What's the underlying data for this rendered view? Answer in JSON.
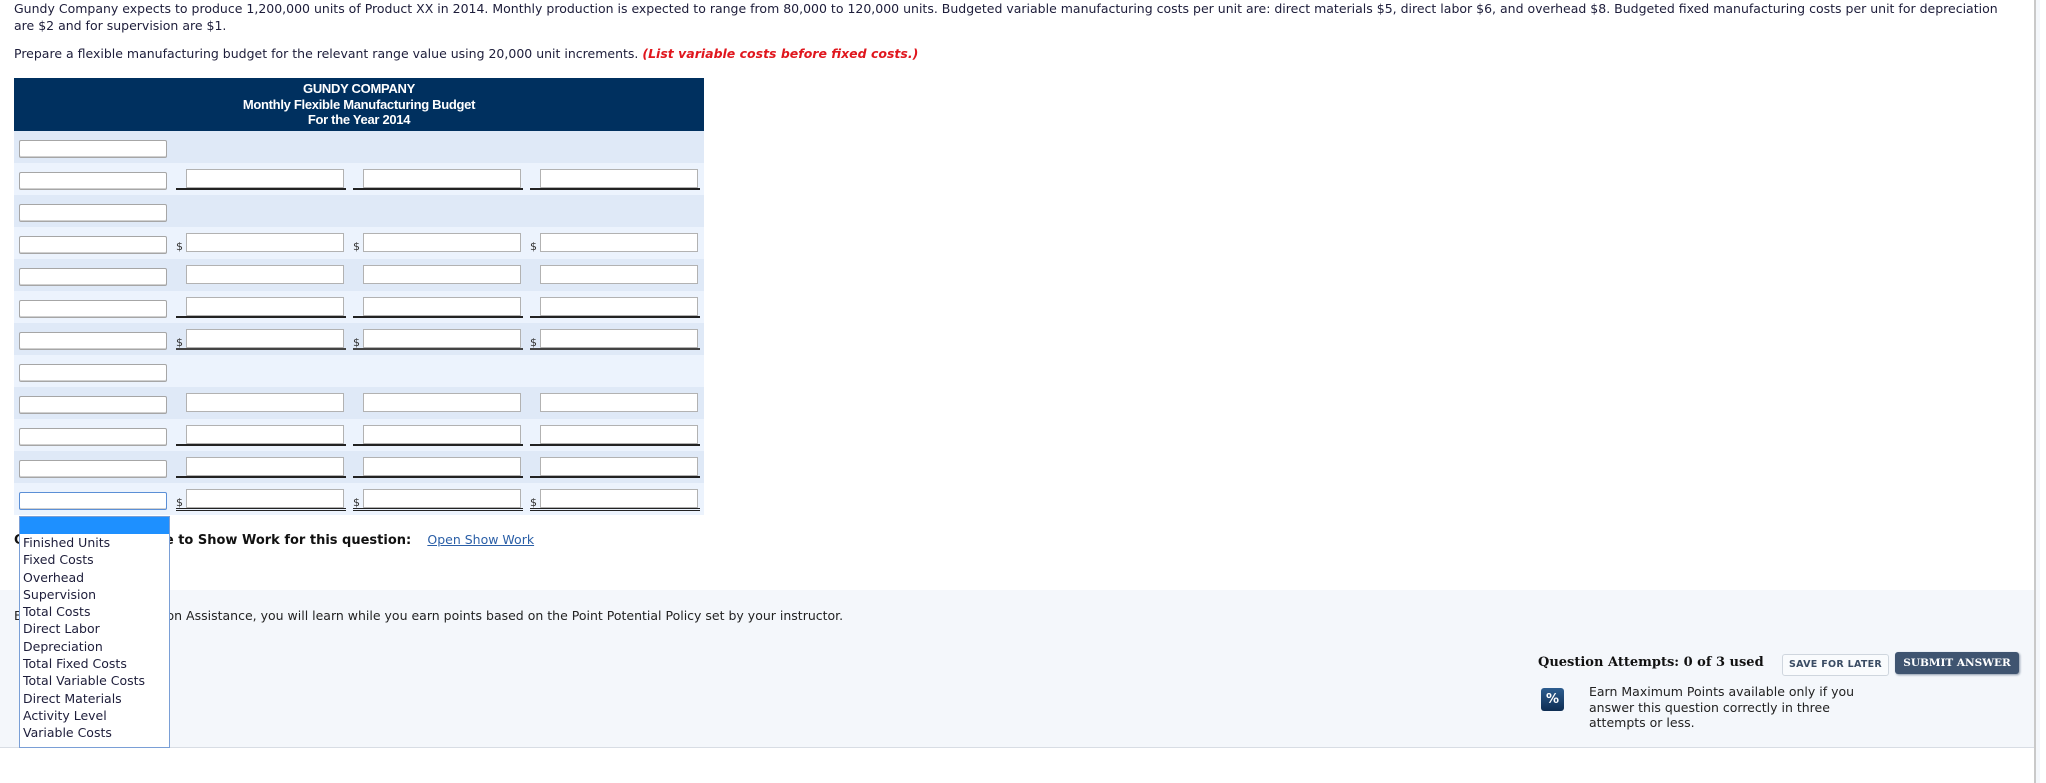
{
  "question": {
    "text": "Gundy Company expects to produce 1,200,000 units of Product XX in 2014. Monthly production is expected to range from 80,000 to 120,000 units. Budgeted variable manufacturing costs per unit are: direct materials $5, direct labor $6, and overhead $8. Budgeted fixed manufacturing costs per unit for depreciation are $2 and for supervision are $1.",
    "instruction": "Prepare a flexible manufacturing budget for the relevant range value using 20,000 unit increments.",
    "instruction_note": "(List variable costs before fixed costs.)"
  },
  "budget": {
    "company": "GUNDY COMPANY",
    "title": "Monthly Flexible Manufacturing Budget",
    "period": "For the Year 2014",
    "currency_symbol": "$",
    "rows": [
      {
        "label": "",
        "prefix": "none",
        "inputs": []
      },
      {
        "label": "",
        "prefix": "_",
        "inputs": [
          "",
          "",
          ""
        ]
      },
      {
        "label": "",
        "prefix": "none",
        "inputs": []
      },
      {
        "label": "",
        "prefix": "$",
        "inputs": [
          "",
          "",
          ""
        ]
      },
      {
        "label": "",
        "prefix": "",
        "inputs": [
          "",
          "",
          ""
        ]
      },
      {
        "label": "",
        "prefix": "_",
        "inputs": [
          "",
          "",
          ""
        ]
      },
      {
        "label": "",
        "prefix": "$",
        "inputs": [
          "",
          "",
          ""
        ]
      },
      {
        "label": "",
        "prefix": "none",
        "inputs": []
      },
      {
        "label": "",
        "prefix": "",
        "inputs": [
          "",
          "",
          ""
        ]
      },
      {
        "label": "",
        "prefix": "_",
        "inputs": [
          "",
          "",
          ""
        ]
      },
      {
        "label": "",
        "prefix": "_",
        "inputs": [
          "",
          "",
          ""
        ]
      },
      {
        "label": "",
        "prefix": "$",
        "inputs": [
          "",
          "",
          ""
        ]
      }
    ]
  },
  "dropdown": {
    "open": true,
    "highlighted_option": "",
    "options": [
      "",
      "Finished Units",
      "Fixed Costs",
      "Overhead",
      "Supervision",
      "Total Costs",
      "Direct Labor",
      "Depreciation",
      "Total Fixed Costs",
      "Total Variable Costs",
      "Direct Materials",
      "Activity Level",
      "Variable Costs"
    ]
  },
  "show_work": {
    "prompt": "Click if you would like to Show Work for this question:",
    "link": "Open Show Work"
  },
  "footer": {
    "assistance_text": "By accessing this Question Assistance, you will learn while you earn points based on the Point Potential Policy set by your instructor.",
    "attempts": "Question Attempts: 0 of 3 used",
    "save_label": "SAVE FOR LATER",
    "submit_label": "SUBMIT ANSWER",
    "percent_icon": "%",
    "max_points_text": "Earn Maximum Points available only if you answer this question correctly in three attempts or less."
  }
}
